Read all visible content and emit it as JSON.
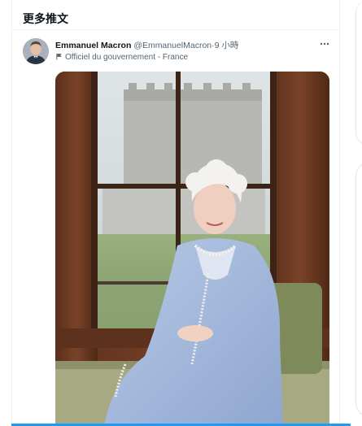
{
  "section": {
    "title": "更多推文"
  },
  "tweet": {
    "author_name": "Emmanuel Macron",
    "handle": "@EmmanuelMacron",
    "separator": "·",
    "time": "9 小時",
    "affiliation": "Officiel du gouvernement - France",
    "icons": {
      "affiliation": "flag-icon",
      "more": "more-horizontal-icon"
    },
    "media_alt": "Photo"
  },
  "colors": {
    "accent": "#1d9bf0",
    "text_primary": "#0f1419",
    "text_secondary": "#536471",
    "border": "#eff3f4"
  }
}
